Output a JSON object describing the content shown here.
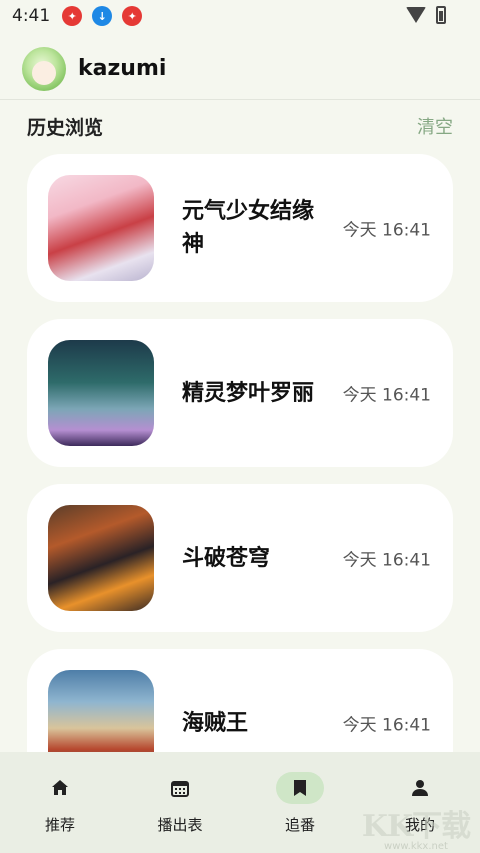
{
  "status_bar": {
    "time": "4:41",
    "notifications": [
      "app-notification-icon",
      "download-icon",
      "app-notification-icon"
    ]
  },
  "header": {
    "username": "kazumi"
  },
  "history": {
    "title": "历史浏览",
    "clear_label": "清空",
    "items": [
      {
        "title": "元气少女结缘神",
        "time": "今天 16:41"
      },
      {
        "title": "精灵梦叶罗丽",
        "time": "今天 16:41"
      },
      {
        "title": "斗破苍穹",
        "time": "今天 16:41"
      },
      {
        "title": "海贼王",
        "time": "今天 16:41"
      }
    ]
  },
  "bottom_nav": {
    "items": [
      {
        "label": "推荐",
        "icon": "home-icon"
      },
      {
        "label": "播出表",
        "icon": "calendar-icon"
      },
      {
        "label": "追番",
        "icon": "bookmark-icon",
        "active": true
      },
      {
        "label": "我的",
        "icon": "person-icon"
      }
    ]
  },
  "watermark": {
    "logo": "KK下载",
    "url": "www.kkx.net"
  },
  "colors": {
    "background": "#f5f7ef",
    "accent_light": "#cfe6c7",
    "clear_text": "#86a884",
    "nav_background": "#eaeee4"
  }
}
